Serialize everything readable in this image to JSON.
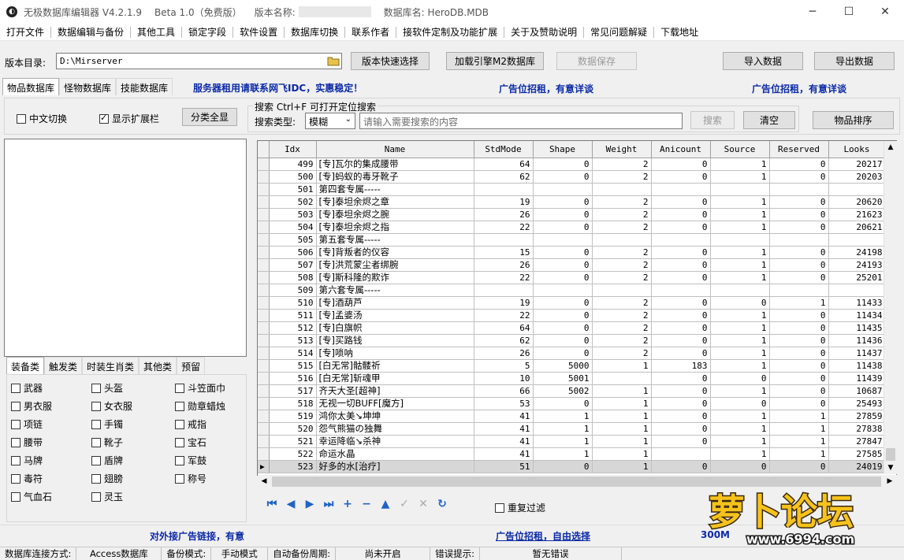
{
  "titlebar": {
    "app": "无极数据库编辑器 V4.2.1.9",
    "beta": "Beta 1.0（免费版）",
    "version_label": "版本名称:",
    "db_label": "数据库名: HeroDB.MDB",
    "minimize": "─",
    "maximize": "☐",
    "close": "✕"
  },
  "menu": [
    "打开文件",
    "数据编辑与备份",
    "其他工具",
    "锁定字段",
    "软件设置",
    "数据库切换",
    "联系作者",
    "接软件定制及功能扩展",
    "关于及赞助说明",
    "常见问题解疑",
    "下载地址"
  ],
  "toolbar": {
    "dir_label": "版本目录:",
    "dir_value": "D:\\Mirserver",
    "quick_select": "版本快速选择",
    "load_engine": "加载引擎M2数据库",
    "save_data": "数据保存",
    "import": "导入数据",
    "export": "导出数据"
  },
  "tabs": [
    "物品数据库",
    "怪物数据库",
    "技能数据库"
  ],
  "banner": {
    "server": "服务器租用请联系网飞IDC，实惠稳定！",
    "ad1": "广告位招租，有意详谈",
    "ad2": "广告位招租，有意详谈"
  },
  "options": {
    "chinese": "中文切换",
    "show_ext": "显示扩展栏",
    "show_all": "分类全显"
  },
  "search": {
    "title": "搜索  Ctrl+F 可打开定位搜索",
    "type_label": "搜索类型:",
    "type_value": "模糊",
    "placeholder": "请输入需要搜索的内容",
    "search_btn": "搜索",
    "clear_btn": "清空",
    "sort_btn": "物品排序"
  },
  "category_tabs": [
    "装备类",
    "触发类",
    "时装生肖类",
    "其他类",
    "预留"
  ],
  "categories": [
    [
      "武器",
      "头盔",
      "斗笠面巾"
    ],
    [
      "男衣服",
      "女衣服",
      "勋章蜡烛"
    ],
    [
      "项链",
      "手镯",
      "戒指"
    ],
    [
      "腰带",
      "靴子",
      "宝石"
    ],
    [
      "马牌",
      "盾牌",
      "军鼓"
    ],
    [
      "毒符",
      "翅膀",
      "称号"
    ],
    [
      "气血石",
      "灵玉",
      ""
    ]
  ],
  "columns": [
    "Idx",
    "Name",
    "StdMode",
    "Shape",
    "Weight",
    "Anicount",
    "Source",
    "Reserved",
    "Looks"
  ],
  "rows": [
    [
      "499",
      "[专]瓦尔的集成腰带",
      "64",
      "0",
      "2",
      "0",
      "1",
      "0",
      "20217"
    ],
    [
      "500",
      "[专]蚂蚁的毒牙靴子",
      "62",
      "0",
      "2",
      "0",
      "1",
      "0",
      "20203"
    ],
    [
      "501",
      "第四套专属-----",
      "",
      "",
      "",
      "",
      "",
      "",
      ""
    ],
    [
      "502",
      "[专]泰坦余烬之章",
      "19",
      "0",
      "2",
      "0",
      "1",
      "0",
      "20620"
    ],
    [
      "503",
      "[专]泰坦余烬之腕",
      "26",
      "0",
      "2",
      "0",
      "1",
      "0",
      "21623"
    ],
    [
      "504",
      "[专]泰坦余烬之指",
      "22",
      "0",
      "2",
      "0",
      "1",
      "0",
      "20621"
    ],
    [
      "505",
      "第五套专属-----",
      "",
      "",
      "",
      "",
      "",
      "",
      ""
    ],
    [
      "506",
      "[专]背叛者的仪容",
      "15",
      "0",
      "2",
      "0",
      "1",
      "0",
      "24198"
    ],
    [
      "507",
      "[专]洪荒蒙尘者绑腕",
      "26",
      "0",
      "2",
      "0",
      "1",
      "0",
      "24193"
    ],
    [
      "508",
      "[专]斯科隆的欺诈",
      "22",
      "0",
      "2",
      "0",
      "1",
      "0",
      "25201"
    ],
    [
      "509",
      "第六套专属-----",
      "",
      "",
      "",
      "",
      "",
      "",
      ""
    ],
    [
      "510",
      "[专]酒葫芦",
      "19",
      "0",
      "2",
      "0",
      "0",
      "1",
      "11433"
    ],
    [
      "511",
      "[专]孟婆汤",
      "22",
      "0",
      "2",
      "0",
      "1",
      "0",
      "11434"
    ],
    [
      "512",
      "[专]白旗帜",
      "64",
      "0",
      "2",
      "0",
      "1",
      "0",
      "11435"
    ],
    [
      "513",
      "[专]买路钱",
      "62",
      "0",
      "2",
      "0",
      "1",
      "0",
      "11436"
    ],
    [
      "514",
      "[专]唢呐",
      "26",
      "0",
      "2",
      "0",
      "1",
      "0",
      "11437"
    ],
    [
      "515",
      "[白无常]骷髅祈",
      "5",
      "5000",
      "1",
      "183",
      "1",
      "0",
      "11438"
    ],
    [
      "516",
      "[白无常]斩魂甲",
      "10",
      "5001",
      "",
      "0",
      "0",
      "0",
      "11439"
    ],
    [
      "517",
      "齐天大圣[超神]",
      "66",
      "5002",
      "1",
      "0",
      "1",
      "0",
      "10687"
    ],
    [
      "518",
      "无视一切BUFF[魔方]",
      "53",
      "0",
      "1",
      "0",
      "0",
      "0",
      "25493"
    ],
    [
      "519",
      "鸿你太美↘坤坤",
      "41",
      "1",
      "1",
      "0",
      "1",
      "1",
      "27859"
    ],
    [
      "520",
      "怨气熊猫の独舞",
      "41",
      "1",
      "1",
      "0",
      "1",
      "1",
      "27838"
    ],
    [
      "521",
      "幸运降临↘杀神",
      "41",
      "1",
      "1",
      "0",
      "1",
      "1",
      "27847"
    ],
    [
      "522",
      "命运水晶",
      "41",
      "1",
      "1",
      "",
      "1",
      "1",
      "27585"
    ],
    [
      "523",
      "好多的水[治疗]",
      "51",
      "0",
      "1",
      "0",
      "0",
      "0",
      "24019"
    ]
  ],
  "repeat_filter": "重复过滤",
  "bottom_banner": {
    "left": "对外接广告链接，有意",
    "mid": "广告位招租，自由选择",
    "right": "300M"
  },
  "status": {
    "conn_label": "数据库连接方式:",
    "conn_value": "Access数据库",
    "backup_label": "备份模式:",
    "backup_value": "手动模式",
    "auto_label": "自动备份周期:",
    "auto_value": "尚未开启",
    "err_label": "错误提示:",
    "err_value": "暂无错误"
  },
  "watermark": {
    "brand": "萝卜论坛",
    "url": "www.6994.com"
  }
}
